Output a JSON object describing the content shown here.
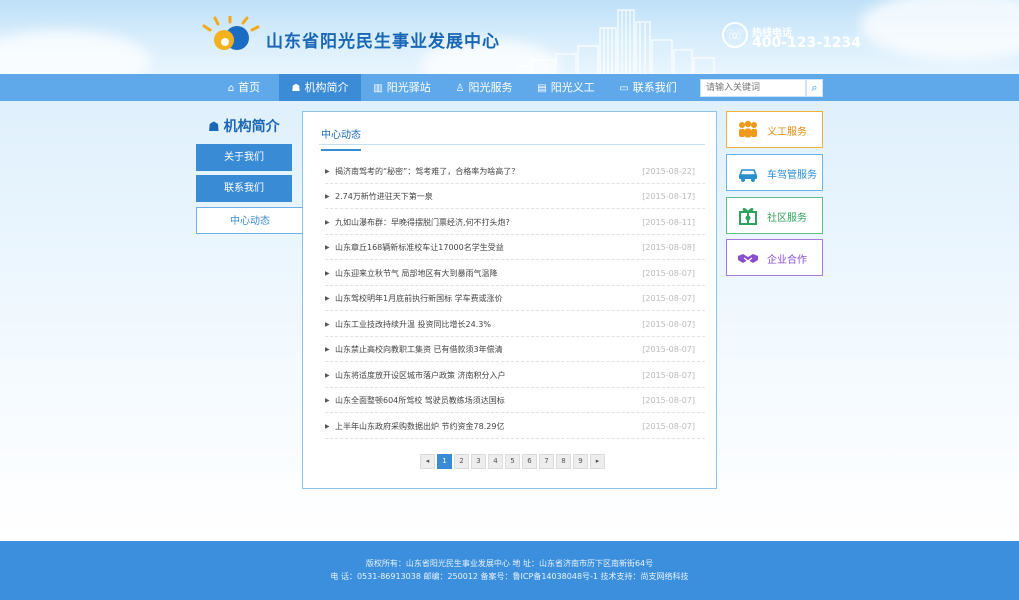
{
  "header": {
    "site_title": "山东省阳光民生事业发展中心",
    "hotline_label": "热线电话",
    "hotline_number": "400-123-1234"
  },
  "nav": {
    "items": [
      {
        "label": "首页",
        "icon": "home-icon"
      },
      {
        "label": "机构简介",
        "icon": "org-chart-icon"
      },
      {
        "label": "阳光驿站",
        "icon": "building-icon"
      },
      {
        "label": "阳光服务",
        "icon": "person-icon"
      },
      {
        "label": "阳光义工",
        "icon": "bank-icon"
      },
      {
        "label": "联系我们",
        "icon": "contact-card-icon"
      }
    ],
    "active_index": 1,
    "search_placeholder": "请输入关键词"
  },
  "sidebar": {
    "title": "机构简介",
    "links": [
      {
        "label": "关于我们"
      },
      {
        "label": "联系我们"
      },
      {
        "label": "中心动态"
      }
    ],
    "active_index": 2
  },
  "main": {
    "tab_label": "中心动态",
    "news": [
      {
        "title": "揭济南驾考的“秘密”：驾考难了，合格率为啥高了？",
        "date": "[2015-08-22]"
      },
      {
        "title": "2.74万新竹进驻天下第一泉",
        "date": "[2015-08-17]"
      },
      {
        "title": "九如山瀑布群：早晚得摆脱门票经济,何不打头炮?",
        "date": "[2015-08-11]"
      },
      {
        "title": "山东章丘168辆新标准校车让17000名学生受益",
        "date": "[2015-08-08]"
      },
      {
        "title": "山东迎来立秋节气 局部地区有大到暴雨气温降",
        "date": "[2015-08-07]"
      },
      {
        "title": "山东驾校明年1月底前执行新国标 学车费或涨价",
        "date": "[2015-08-07]"
      },
      {
        "title": "山东工业技改持续升温 投资同比增长24.3%",
        "date": "[2015-08-07]"
      },
      {
        "title": "山东禁止高校向教职工集资 已有借款须3年偿清",
        "date": "[2015-08-07]"
      },
      {
        "title": "山东将适度放开设区城市落户政策 济南积分入户",
        "date": "[2015-08-07]"
      },
      {
        "title": "山东全面整顿604所驾校 驾驶员教练场须达国标",
        "date": "[2015-08-07]"
      },
      {
        "title": "上半年山东政府采购数据出炉 节约资金78.29亿",
        "date": "[2015-08-07]"
      }
    ],
    "pagination": {
      "prev": "◂",
      "next": "▸",
      "pages": [
        "1",
        "2",
        "3",
        "4",
        "5",
        "6",
        "7",
        "8",
        "9"
      ],
      "current": 1
    }
  },
  "services": [
    {
      "label": "义工服务",
      "icon": "volunteers-icon",
      "color": "#f09a1c"
    },
    {
      "label": "车驾管服务",
      "icon": "car-icon",
      "color": "#2a8fd0"
    },
    {
      "label": "社区服务",
      "icon": "community-gift-icon",
      "color": "#2fa35e"
    },
    {
      "label": "企业合作",
      "icon": "handshake-icon",
      "color": "#8a4fd0"
    }
  ],
  "footer": {
    "line1": "版权所有：山东省阳光民生事业发展中心    地 址：山东省济南市历下区南新街64号",
    "line2": "电 话：0531-86913038    邮编：250012    备案号：鲁ICP备14038048号-1    技术支持：尚支网络科技"
  }
}
